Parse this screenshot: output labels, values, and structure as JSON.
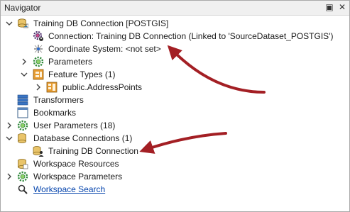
{
  "window": {
    "title": "Navigator",
    "controls": {
      "pin": "▣",
      "close": "✕"
    }
  },
  "tree": {
    "connection_root": "Training DB Connection [POSTGIS]",
    "connection_detail": "Connection: Training DB Connection (Linked to 'SourceDataset_POSTGIS')",
    "coordinate_system": "Coordinate System: <not set>",
    "parameters": "Parameters",
    "feature_types": "Feature Types (1)",
    "feature_type_item": "public.AddressPoints",
    "transformers": "Transformers",
    "bookmarks": "Bookmarks",
    "user_parameters": "User Parameters (18)",
    "database_connections": "Database Connections  (1)",
    "db_connection_item": "Training DB Connection",
    "workspace_resources": "Workspace Resources",
    "workspace_parameters": "Workspace Parameters",
    "workspace_search": "Workspace Search"
  },
  "colors": {
    "annotation_arrow": "#a31f24",
    "link": "#0645ad"
  }
}
